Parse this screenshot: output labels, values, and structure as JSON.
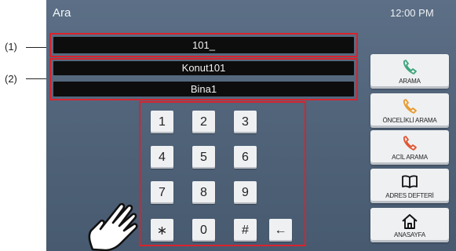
{
  "app": {
    "title": "Ara",
    "time": "12:00 PM"
  },
  "annotations": {
    "label1": "(1)",
    "label2": "(2)"
  },
  "fields": {
    "number_entry": "101_",
    "name": "Konut101",
    "building": "Bina1"
  },
  "keypad": {
    "keys": [
      "1",
      "2",
      "3",
      "4",
      "5",
      "6",
      "7",
      "8",
      "9",
      "∗",
      "0",
      "#",
      "←"
    ]
  },
  "side_buttons": {
    "call": {
      "label": "ARAMA",
      "icon": "phone-icon",
      "color": "#3aa37a"
    },
    "priority_call": {
      "label": "ÖNCELİKLİ ARAMA",
      "icon": "phone-icon",
      "color": "#e89a2c"
    },
    "emergency_call": {
      "label": "ACİL ARAMA",
      "icon": "phone-icon",
      "color": "#e0532f"
    },
    "address_book": {
      "label": "ADRES DEFTERİ",
      "icon": "book-icon"
    },
    "home": {
      "label": "ANASAYFA",
      "icon": "home-icon"
    }
  },
  "colors": {
    "highlight": "#d9232d",
    "screen": "#53667c"
  }
}
